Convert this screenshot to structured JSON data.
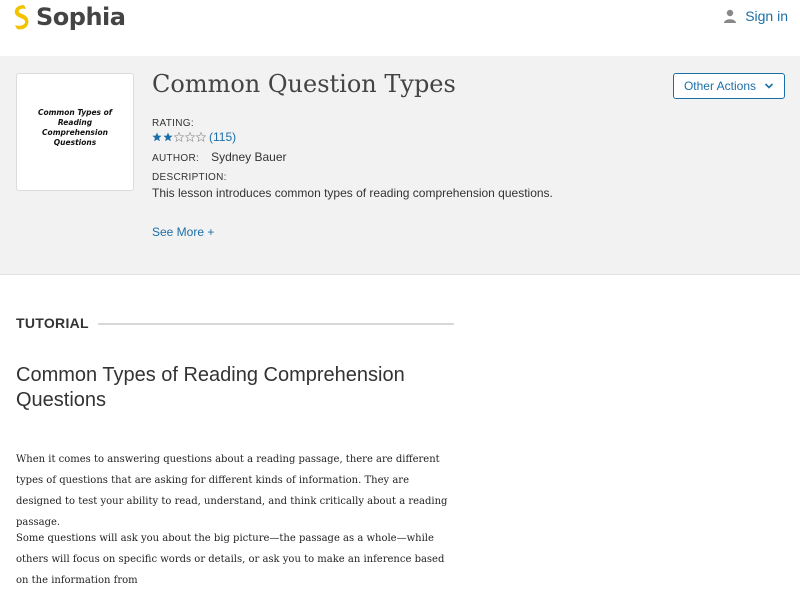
{
  "brand": {
    "name": "Sophia",
    "color": "#f2c200"
  },
  "header_nav": {
    "signin_label": "Sign in",
    "signin_icon": "user-icon"
  },
  "lesson": {
    "title": "Common Question Types",
    "thumbnail_text": "Common Types of Reading Comprehension Questions",
    "rating_label": "RATING:",
    "rating_value": 2,
    "rating_max": 5,
    "rating_count": "(115)",
    "author_label": "AUTHOR:",
    "author_name": "Sydney Bauer",
    "description_label": "DESCRIPTION:",
    "description": "This lesson introduces common types of reading comprehension questions.",
    "see_more": "See More +",
    "other_actions": "Other Actions"
  },
  "tutorial": {
    "section_label": "TUTORIAL",
    "title": "Common Types of Reading Comprehension Questions",
    "paragraph_1": "When it comes to answering questions about a reading passage, there are different types of questions that are asking for different kinds of information. They are designed to test your ability to read, understand, and think critically about a reading passage.",
    "paragraph_2": "Some questions will ask you about the big picture—the passage as a whole—while others will focus on specific words or details, or ask you to make an inference based on the information from"
  },
  "colors": {
    "accent": "#1b6fa8",
    "header_bg": "#f2f2f2"
  }
}
